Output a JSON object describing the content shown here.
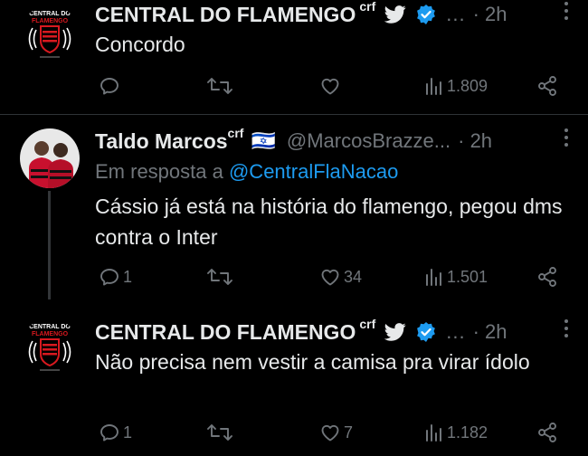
{
  "tweets": [
    {
      "author": "CENTRAL DO FLAMENGO",
      "author_suffix": "crf",
      "handle_ellipsis": "...",
      "time": "· 2h",
      "text": "Concordo",
      "replies": "",
      "likes": "",
      "views": "1.809",
      "avatar_logo_text": "CENTRAL DO FLAMENGO"
    },
    {
      "author": "Taldo Marcos",
      "author_suffix": "crf",
      "flag": "🇮🇱",
      "handle": "@MarcosBrazze...",
      "time": "· 2h",
      "reply_prefix": "Em resposta a",
      "reply_handle": "@CentralFlaNacao",
      "text": "Cássio já está na história do flamengo, pegou dms contra o Inter",
      "replies": "1",
      "likes": "34",
      "views": "1.501"
    },
    {
      "author": "CENTRAL DO FLAMENGO",
      "author_suffix": "crf",
      "handle_ellipsis": "...",
      "time": "· 2h",
      "text": "Não precisa nem vestir a camisa pra virar ídolo",
      "replies": "1",
      "likes": "7",
      "views": "1.182",
      "avatar_logo_text": "CENTRAL DO FLAMENGO"
    }
  ],
  "colors": {
    "background": "#000000",
    "text": "#e7e9ea",
    "muted": "#71767b",
    "link": "#1d9bf0",
    "verified": "#1d9bf0",
    "flamengo_red": "#d8191f"
  },
  "icons": [
    "twitter-bird-icon",
    "verified-badge-icon",
    "reply-icon",
    "retweet-icon",
    "like-icon",
    "views-icon",
    "share-icon",
    "more-icon"
  ]
}
